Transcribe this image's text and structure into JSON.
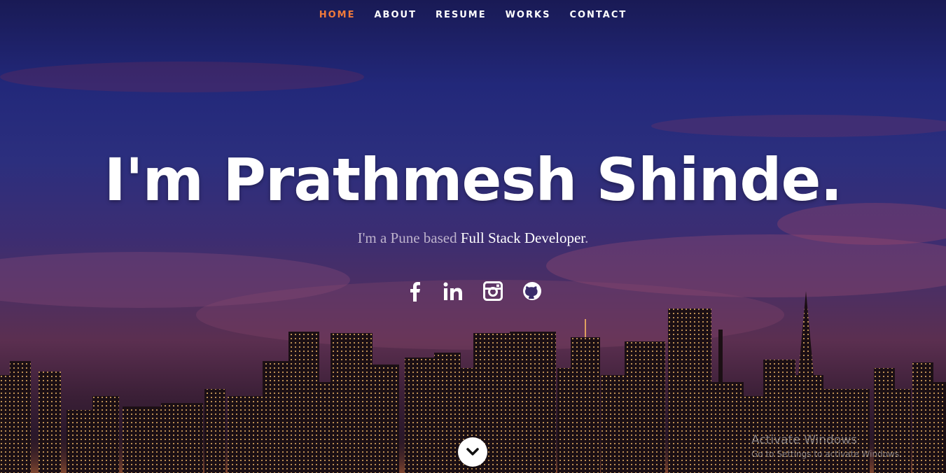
{
  "nav": {
    "items": [
      {
        "label": "HOME",
        "active": true
      },
      {
        "label": "ABOUT",
        "active": false
      },
      {
        "label": "RESUME",
        "active": false
      },
      {
        "label": "WORKS",
        "active": false
      },
      {
        "label": "CONTACT",
        "active": false
      }
    ],
    "active_color": "#f07a3b"
  },
  "hero": {
    "title": "I'm Prathmesh Shinde.",
    "tagline_prefix": "I'm a Pune based ",
    "tagline_role": "Full Stack Developer",
    "tagline_suffix": "."
  },
  "social": [
    {
      "icon": "facebook-icon"
    },
    {
      "icon": "linkedin-icon"
    },
    {
      "icon": "instagram-icon"
    },
    {
      "icon": "github-icon"
    }
  ],
  "scroll_icon": "chevron-down-icon",
  "watermark": {
    "title": "Activate Windows",
    "subtitle": "Go to Settings to activate Windows."
  }
}
